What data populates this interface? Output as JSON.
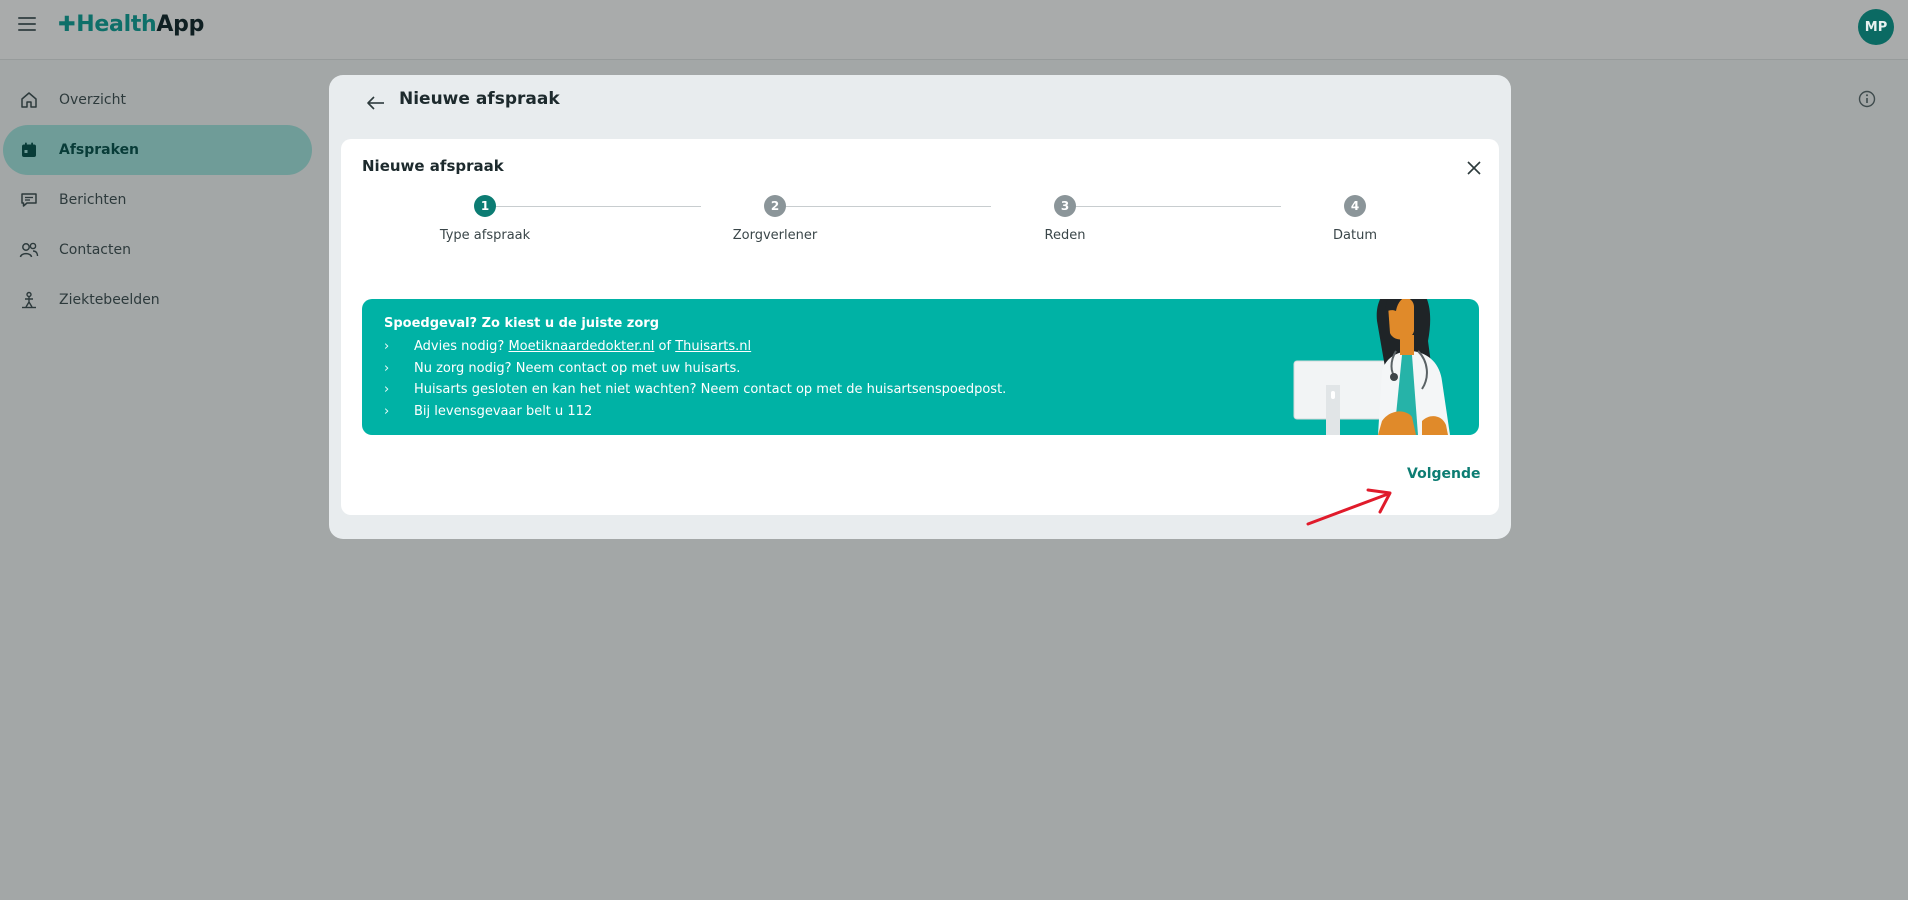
{
  "app": {
    "logo_health": "Health",
    "logo_app": "App",
    "avatar_initials": "MP"
  },
  "sidebar": {
    "items": [
      {
        "label": "Overzicht",
        "icon": "home-icon",
        "active": false
      },
      {
        "label": "Afspraken",
        "icon": "calendar-icon",
        "active": true
      },
      {
        "label": "Berichten",
        "icon": "message-icon",
        "active": false
      },
      {
        "label": "Contacten",
        "icon": "contacts-icon",
        "active": false
      },
      {
        "label": "Ziektebeelden",
        "icon": "condition-icon",
        "active": false
      }
    ]
  },
  "modal": {
    "outer_title": "Nieuwe afspraak",
    "inner_title": "Nieuwe afspraak",
    "steps": [
      {
        "number": "1",
        "label": "Type afspraak",
        "active": true
      },
      {
        "number": "2",
        "label": "Zorgverlener",
        "active": false
      },
      {
        "number": "3",
        "label": "Reden",
        "active": false
      },
      {
        "number": "4",
        "label": "Datum",
        "active": false
      }
    ],
    "banner": {
      "title": "Spoedgeval? Zo kiest u de juiste zorg",
      "line1_prefix": "Advies nodig? ",
      "line1_link1": "Moetiknaardedokter.nl",
      "line1_middle": " of ",
      "line1_link2": "Thuisarts.nl",
      "line2": "Nu zorg nodig? Neem contact op met uw huisarts.",
      "line3": "Huisarts gesloten en kan het niet wachten? Neem contact op met de huisartsenspoedpost.",
      "line4": "Bij levensgevaar belt u 112"
    },
    "next_label": "Volgende"
  },
  "colors": {
    "brand": "#0e6f69",
    "banner": "#00b2a5",
    "active_nav": "#6f9c98",
    "annotation_arrow": "#e01b2b"
  }
}
